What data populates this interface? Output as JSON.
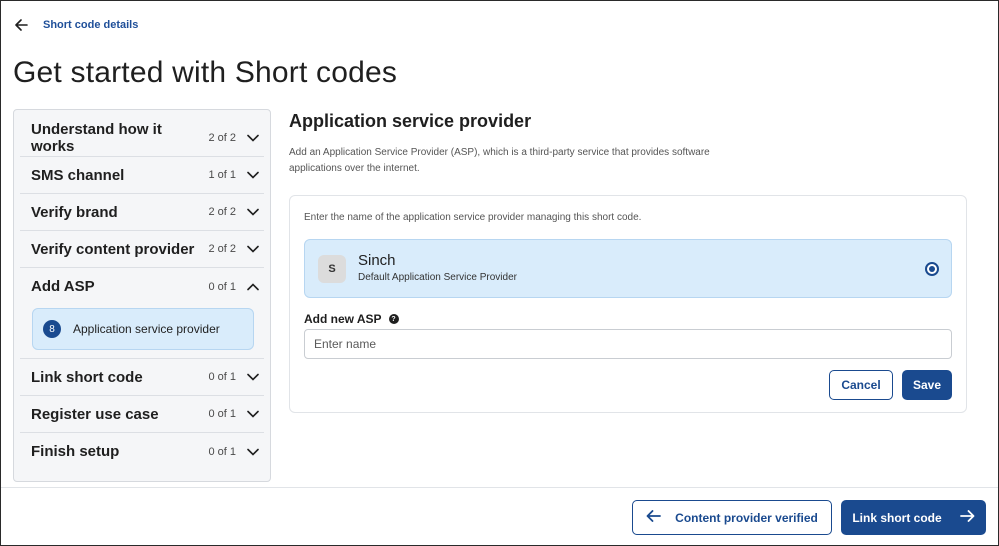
{
  "header": {
    "back_label": "Short code details",
    "title": "Get started with Short codes"
  },
  "sidebar": {
    "steps": [
      {
        "label": "Understand how it works",
        "count": "2 of 2",
        "expanded": false
      },
      {
        "label": "SMS channel",
        "count": "1 of 1",
        "expanded": false
      },
      {
        "label": "Verify brand",
        "count": "2 of 2",
        "expanded": false
      },
      {
        "label": "Verify content provider",
        "count": "2 of 2",
        "expanded": false
      },
      {
        "label": "Add ASP",
        "count": "0 of 1",
        "expanded": true
      },
      {
        "label": "Link short code",
        "count": "0 of 1",
        "expanded": false
      },
      {
        "label": "Register use case",
        "count": "0 of 1",
        "expanded": false
      },
      {
        "label": "Finish setup",
        "count": "0 of 1",
        "expanded": false
      }
    ],
    "substep": {
      "number": "8",
      "label": "Application service provider"
    }
  },
  "main": {
    "title": "Application service provider",
    "description": "Add an Application Service Provider (ASP), which is a third-party service that provides software applications over the internet.",
    "card": {
      "hint": "Enter the name of the application service provider managing this short code.",
      "option": {
        "avatar": "S",
        "name": "Sinch",
        "subtitle": "Default Application Service Provider",
        "selected": true
      },
      "add_label": "Add new ASP",
      "input_placeholder": "Enter name",
      "cancel_label": "Cancel",
      "save_label": "Save"
    }
  },
  "footer": {
    "prev_label": "Content provider verified",
    "next_label": "Link short code"
  },
  "colors": {
    "primary": "#1a4a8f",
    "selected_bg": "#d9ecfb",
    "sidebar_bg": "#f5f6f8"
  }
}
